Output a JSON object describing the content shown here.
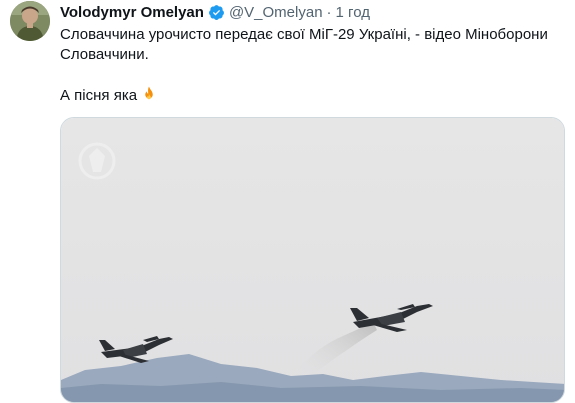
{
  "tweet": {
    "author": {
      "display_name": "Volodymyr Omelyan",
      "handle": "@V_Omelyan",
      "verified": true
    },
    "separator": "·",
    "timestamp": "1 год",
    "text": {
      "line1": "Словаччина урочисто передає свої МіГ-29 Україні, - відео Міноборони",
      "line2": "Словаччини.",
      "line3": "А пісня яка"
    },
    "emoji": "fire-icon",
    "media": {
      "type": "video-frame",
      "description_icon": "watermark-emblem-icon"
    }
  },
  "colors": {
    "verified": "#1d9bf0",
    "secondary_text": "#536471",
    "sky": "#e4e4e4",
    "mountains": "#8f9fb4"
  }
}
